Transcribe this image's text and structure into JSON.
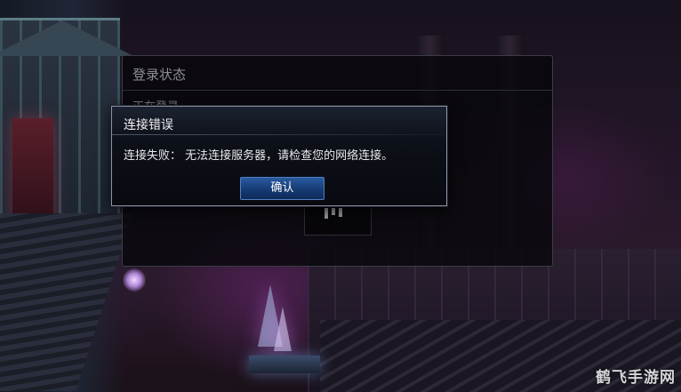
{
  "login_panel": {
    "title": "登录状态",
    "status": "正在登录......"
  },
  "error_dialog": {
    "title": "连接错误",
    "message": "连接失败： 无法连接服务器，请检查您的网络连接。",
    "confirm_label": "确认"
  },
  "watermark": "鹤飞手游网",
  "colors": {
    "dialog_border": "#8b93a8",
    "confirm_button": "#1f4a8a",
    "panel_bg": "#06060a"
  }
}
